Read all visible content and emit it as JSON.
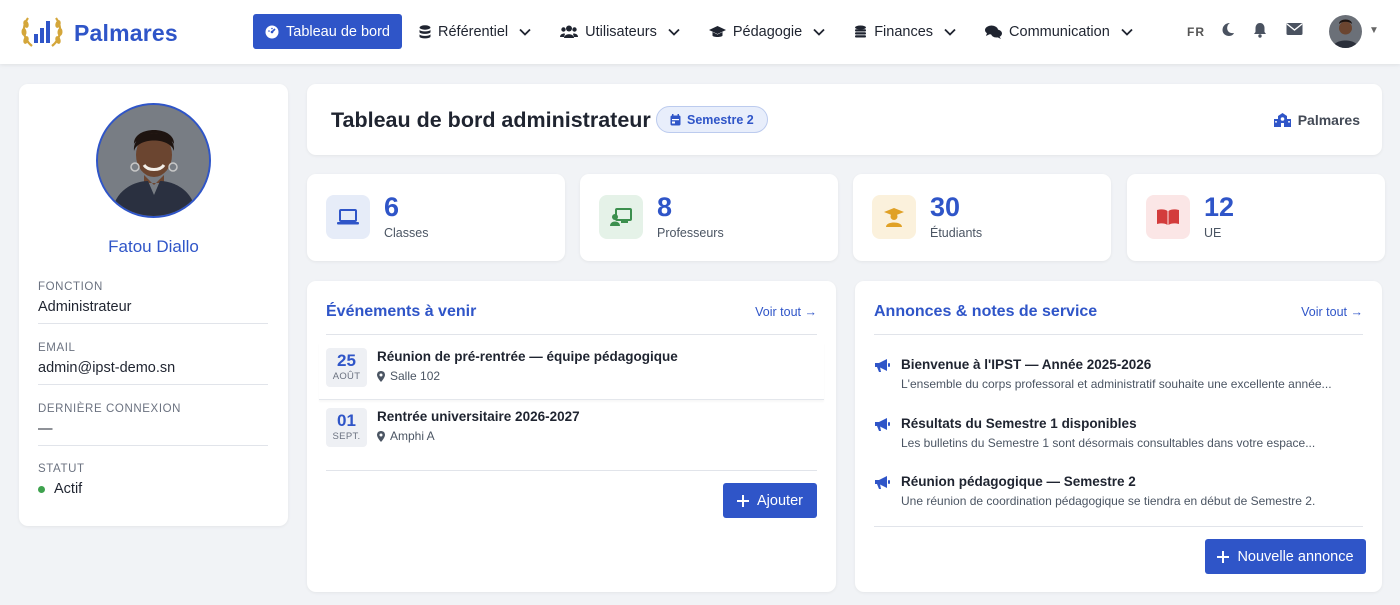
{
  "app": {
    "brand": "Palmares"
  },
  "nav": [
    {
      "label": "Tableau de bord",
      "icon": "dashboard-icon",
      "active": true
    },
    {
      "label": "Référentiel",
      "icon": "database-icon"
    },
    {
      "label": "Utilisateurs",
      "icon": "users-icon"
    },
    {
      "label": "Pédagogie",
      "icon": "graduation-cap-icon"
    },
    {
      "label": "Finances",
      "icon": "coins-icon"
    },
    {
      "label": "Communication",
      "icon": "comments-icon"
    }
  ],
  "toolbar": {
    "lang": "FR"
  },
  "profile": {
    "name": "Fatou Diallo",
    "fields": [
      {
        "label": "FONCTION",
        "value": "Administrateur"
      },
      {
        "label": "EMAIL",
        "value": "admin@ipst-demo.sn"
      },
      {
        "label": "DERNIÈRE CONNEXION",
        "value": "—"
      },
      {
        "label": "STATUT",
        "value": "Actif"
      }
    ]
  },
  "header": {
    "title": "Tableau de bord administrateur",
    "semester": "Semestre 2",
    "right_label": "Palmares"
  },
  "stats": [
    {
      "value": "6",
      "label": "Classes",
      "icon": "laptop-icon",
      "bg": "#e6ecf8",
      "fg": "#2f55c8"
    },
    {
      "value": "8",
      "label": "Professeurs",
      "icon": "teacher-icon",
      "bg": "#e5f2e8",
      "fg": "#3c8f4e"
    },
    {
      "value": "30",
      "label": "Étudiants",
      "icon": "student-icon",
      "bg": "#fbf1dc",
      "fg": "#e0a126"
    },
    {
      "value": "12",
      "label": "UE",
      "icon": "book-icon",
      "bg": "#fbe6e6",
      "fg": "#d33c3c"
    }
  ],
  "events": {
    "title": "Événements à venir",
    "link": "Voir tout →",
    "items": [
      {
        "day": "25",
        "month": "AOÛT",
        "title": "Réunion de pré-rentrée — équipe pédagogique",
        "place": "Salle 102"
      },
      {
        "day": "01",
        "month": "SEPT.",
        "title": "Rentrée universitaire 2026-2027",
        "place": "Amphi A"
      }
    ],
    "button": "Ajouter"
  },
  "annonces": {
    "title": "Annonces & notes de service",
    "link": "Voir tout →",
    "items": [
      {
        "title": "Bienvenue à l'IPST — Année 2025-2026",
        "text": "L'ensemble du corps professoral et administratif souhaite une excellente année..."
      },
      {
        "title": "Résultats du Semestre 1 disponibles",
        "text": "Les bulletins du Semestre 1 sont désormais consultables dans votre espace..."
      },
      {
        "title": "Réunion pédagogique — Semestre 2",
        "text": "Une réunion de coordination pédagogique se tiendra en début de Semestre 2."
      }
    ],
    "button": "Nouvelle annonce"
  },
  "colors": {
    "accent": "#2f55c8",
    "status_active": "#3ea24e"
  }
}
